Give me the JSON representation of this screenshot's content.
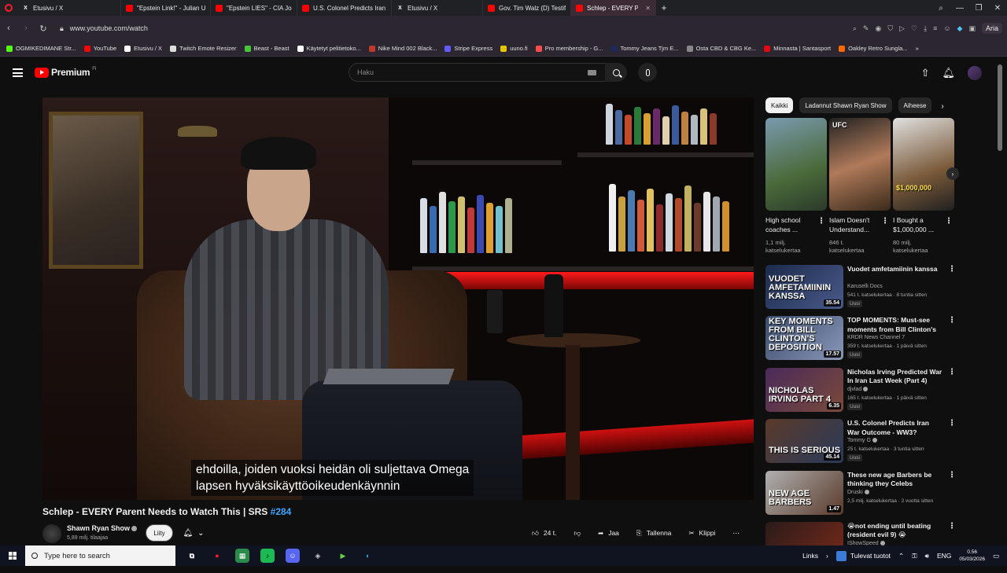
{
  "browser": {
    "tabs": [
      {
        "label": "Etusivu / X",
        "icon": "x-icon",
        "width": 132
      },
      {
        "label": "\"Epstein Link!\" - Julian U",
        "icon": "youtube-icon",
        "width": 114
      },
      {
        "label": "\"Epstein LIES\" - CIA John",
        "icon": "youtube-icon",
        "width": 110
      },
      {
        "label": "U.S. Colonel Predicts Iran",
        "icon": "youtube-icon",
        "width": 120
      },
      {
        "label": "Etusivu / X",
        "icon": "x-icon",
        "width": 116
      },
      {
        "label": "Gov. Tim Walz (D) Testifie",
        "icon": "youtube-icon",
        "width": 112
      },
      {
        "label": "Schlep - EVERY Parent Ne",
        "icon": "youtube-icon",
        "width": 108,
        "active": true
      }
    ],
    "url": "www.youtube.com/watch",
    "ai_label": "Aria",
    "bookmarks": [
      {
        "label": "OGMIKEDIMANE Str...",
        "color": "#53fc18"
      },
      {
        "label": "YouTube",
        "color": "#ff0000"
      },
      {
        "label": "Etusivu / X",
        "color": "#ffffff"
      },
      {
        "label": "Twitch Emote Resizer",
        "color": "#dddddd"
      },
      {
        "label": "Beast - Beast",
        "color": "#45c43c"
      },
      {
        "label": "Käytetyt pelitietoko...",
        "color": "#ffffff"
      },
      {
        "label": "Nike Mind 002 Black...",
        "color": "#c0392b"
      },
      {
        "label": "Stripe Express",
        "color": "#635bff"
      },
      {
        "label": "uuno.fi",
        "color": "#e6c500"
      },
      {
        "label": "Pro membership - G...",
        "color": "#ff4d4d"
      },
      {
        "label": "Tommy Jeans Tjm E...",
        "color": "#1b2a5a"
      },
      {
        "label": "Osta CBD & CBG Ke...",
        "color": "#888888"
      },
      {
        "label": "Minnasta | Santasport",
        "color": "#e30613"
      },
      {
        "label": "Oakley Retro Sungla...",
        "color": "#ff6a00"
      }
    ]
  },
  "youtube": {
    "logo_text": "Premium",
    "logo_sup": "FI",
    "search_placeholder": "Haku",
    "video": {
      "subtitle_line1": "ehdoilla, joiden vuoksi heidän oli suljettava Omega",
      "subtitle_line2": "lapsen hyväksikäyttöoikeudenkäynnin",
      "title": "Schlep - EVERY Parent Needs to Watch This | SRS ",
      "title_tag": "#284",
      "channel_name": "Shawn Ryan Show",
      "channel_subs": "5,89 milj. tilaajaa",
      "join_label": "Liity",
      "likes": "24 t.",
      "share_label": "Jaa",
      "save_label": "Tallenna",
      "clip_label": "Klippi"
    },
    "chips": [
      {
        "label": "Kaikki",
        "active": true
      },
      {
        "label": "Ladannut Shawn Ryan Show"
      },
      {
        "label": "Aiheese"
      }
    ],
    "shorts": [
      {
        "title": "High school coaches ...",
        "views": "1,1 milj. katselukertaa",
        "overlay": ""
      },
      {
        "title": "Islam Doesn't Understand...",
        "views": "846 t. katselukertaa",
        "overlay": "UFC"
      },
      {
        "title": "I Bought a $1,000,000 ...",
        "views": "80 milj. katselukertaa",
        "overlay": "$1,000,000"
      }
    ],
    "recommendations": [
      {
        "title": "Vuodet amfetamiinin kanssa",
        "channel": "Karuselli Docs",
        "meta": "541 t. katselukertaa · 8 tuntia sitten",
        "badge": "Uusi",
        "duration": "35.54",
        "overlay": "VUODET AMFETAMIININ KANSSA",
        "bg": "linear-gradient(135deg,#1c2a4a,#4a5a8a)",
        "verified": false
      },
      {
        "title": "TOP MOMENTS: Must-see moments from Bill Clinton's ...",
        "channel": "KRDR News Channel 7",
        "meta": "359 t. katselukertaa · 1 päivä sitten",
        "badge": "Uusi",
        "duration": "17.57",
        "overlay": "KEY MOMENTS FROM BILL CLINTON'S DEPOSITION",
        "bg": "linear-gradient(135deg,#3a4a6a,#8a98b8)",
        "verified": false
      },
      {
        "title": "Nicholas Irving Predicted War In Iran Last Week (Part 4)",
        "channel": "djvlad",
        "meta": "165 t. katselukertaa · 1 päivä sitten",
        "badge": "Uusi",
        "duration": "6.35",
        "overlay": "NICHOLAS IRVING PART 4",
        "bg": "linear-gradient(135deg,#4a2a5a,#7a4a3a)",
        "verified": true
      },
      {
        "title": "U.S. Colonel Predicts Iran War Outcome - WW3?",
        "channel": "Tommy G",
        "meta": "25 t. katselukertaa · 3 tuntia sitten",
        "badge": "Uusi",
        "duration": "45.14",
        "overlay": "THIS IS SERIOUS",
        "bg": "linear-gradient(135deg,#5a3a2a,#2a3a5a)",
        "verified": true
      },
      {
        "title": "These new age Barbers be thinking they Celebs",
        "channel": "Druski",
        "meta": "2,5 milj. katselukertaa · 2 vuotta sitten",
        "badge": "",
        "duration": "1.47",
        "overlay": "NEW AGE BARBERS",
        "bg": "linear-gradient(135deg,#b0b0b0,#5a3a2a)",
        "verified": true
      },
      {
        "title": "😭not ending until beating (resident evil 9) 😭",
        "channel": "IShowSpeed",
        "meta": "",
        "badge": "",
        "duration": "",
        "overlay": "",
        "bg": "linear-gradient(135deg,#2a1a1a,#7a2a1a)",
        "verified": true
      }
    ]
  },
  "taskbar": {
    "search_placeholder": "Type here to search",
    "links_label": "Links",
    "weather_label": "Tulevat tuotot",
    "lang": "ENG",
    "time": "0.56",
    "date": "05/03/2026"
  }
}
